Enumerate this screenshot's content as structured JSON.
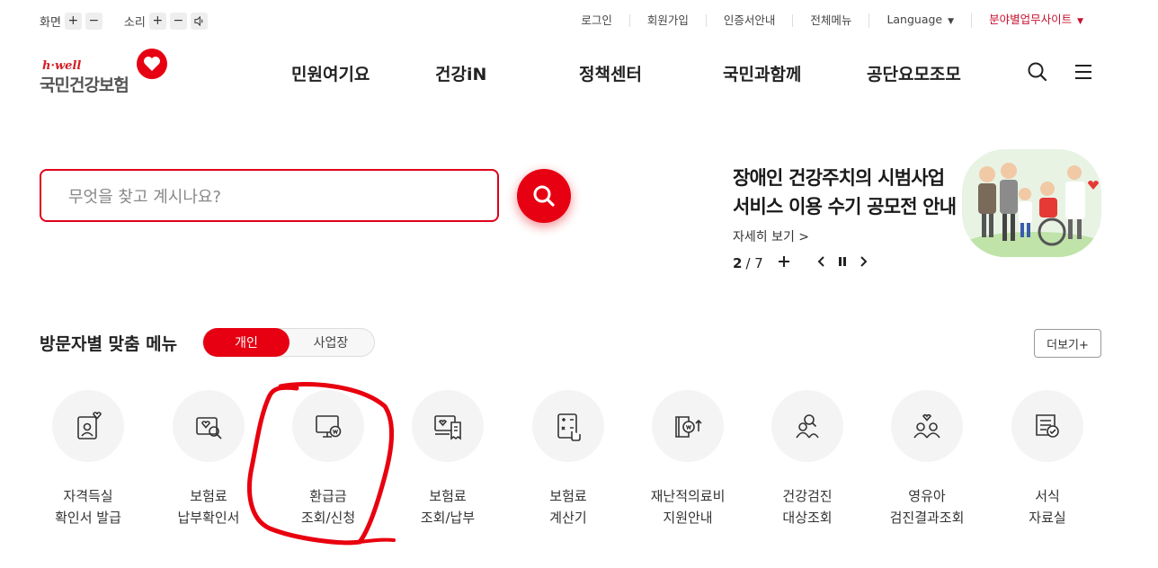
{
  "util": {
    "screen_label": "화면",
    "sound_label": "소리",
    "links": [
      "로그인",
      "회원가입",
      "인증서안내",
      "전체메뉴"
    ],
    "language": "Language",
    "partner_site": "분야별업무사이트"
  },
  "logo": {
    "sub": "h·well",
    "main": "국민건강보험"
  },
  "nav": [
    "민원여기요",
    "건강iN",
    "정책센터",
    "국민과함께",
    "공단요모조모"
  ],
  "search": {
    "placeholder": "무엇을 찾고 계시나요?"
  },
  "banner": {
    "title_line1": "장애인 건강주치의 시범사업",
    "title_line2": "서비스 이용 수기 공모전 안내",
    "more": "자세히 보기 >",
    "current": "2",
    "total": "/ 7"
  },
  "visitor_menu": {
    "title": "방문자별 맞춤 메뉴",
    "tab_personal": "개인",
    "tab_business": "사업장",
    "more": "더보기+",
    "items": [
      {
        "line1": "자격득실",
        "line2": "확인서 발급",
        "icon": "certificate-icon"
      },
      {
        "line1": "보험료",
        "line2": "납부확인서",
        "icon": "payment-search-icon"
      },
      {
        "line1": "환급금",
        "line2": "조회/신청",
        "icon": "refund-monitor-icon"
      },
      {
        "line1": "보험료",
        "line2": "조회/납부",
        "icon": "premium-receipt-icon"
      },
      {
        "line1": "보험료",
        "line2": "계산기",
        "icon": "calculator-icon"
      },
      {
        "line1": "재난적의료비",
        "line2": "지원안내",
        "icon": "medical-support-icon"
      },
      {
        "line1": "건강검진",
        "line2": "대상조회",
        "icon": "checkup-people-icon"
      },
      {
        "line1": "영유아",
        "line2": "검진결과조회",
        "icon": "infant-checkup-icon"
      },
      {
        "line1": "서식",
        "line2": "자료실",
        "icon": "forms-icon"
      }
    ]
  },
  "colors": {
    "accent": "#e60012",
    "annotation": "#e8000f"
  }
}
